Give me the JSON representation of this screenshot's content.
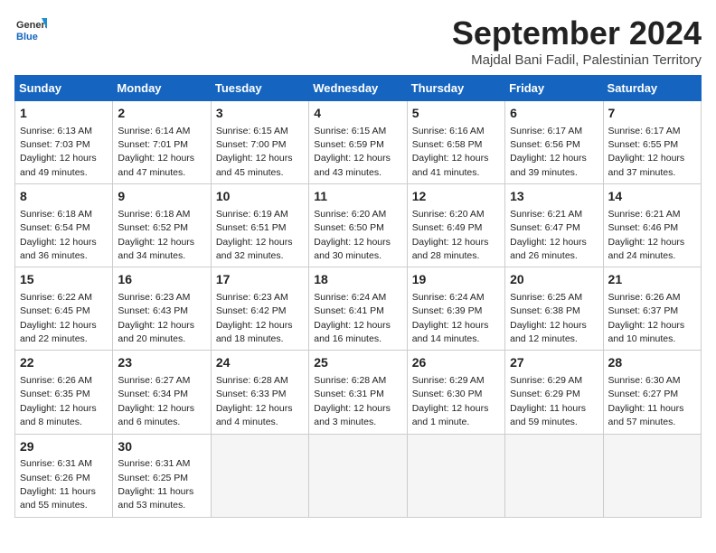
{
  "header": {
    "logo_general": "General",
    "logo_blue": "Blue",
    "title": "September 2024",
    "location": "Majdal Bani Fadil, Palestinian Territory"
  },
  "days_of_week": [
    "Sunday",
    "Monday",
    "Tuesday",
    "Wednesday",
    "Thursday",
    "Friday",
    "Saturday"
  ],
  "weeks": [
    [
      {
        "day": 1,
        "sunrise": "6:13 AM",
        "sunset": "7:03 PM",
        "daylight": "12 hours and 49 minutes."
      },
      {
        "day": 2,
        "sunrise": "6:14 AM",
        "sunset": "7:01 PM",
        "daylight": "12 hours and 47 minutes."
      },
      {
        "day": 3,
        "sunrise": "6:15 AM",
        "sunset": "7:00 PM",
        "daylight": "12 hours and 45 minutes."
      },
      {
        "day": 4,
        "sunrise": "6:15 AM",
        "sunset": "6:59 PM",
        "daylight": "12 hours and 43 minutes."
      },
      {
        "day": 5,
        "sunrise": "6:16 AM",
        "sunset": "6:58 PM",
        "daylight": "12 hours and 41 minutes."
      },
      {
        "day": 6,
        "sunrise": "6:17 AM",
        "sunset": "6:56 PM",
        "daylight": "12 hours and 39 minutes."
      },
      {
        "day": 7,
        "sunrise": "6:17 AM",
        "sunset": "6:55 PM",
        "daylight": "12 hours and 37 minutes."
      }
    ],
    [
      {
        "day": 8,
        "sunrise": "6:18 AM",
        "sunset": "6:54 PM",
        "daylight": "12 hours and 36 minutes."
      },
      {
        "day": 9,
        "sunrise": "6:18 AM",
        "sunset": "6:52 PM",
        "daylight": "12 hours and 34 minutes."
      },
      {
        "day": 10,
        "sunrise": "6:19 AM",
        "sunset": "6:51 PM",
        "daylight": "12 hours and 32 minutes."
      },
      {
        "day": 11,
        "sunrise": "6:20 AM",
        "sunset": "6:50 PM",
        "daylight": "12 hours and 30 minutes."
      },
      {
        "day": 12,
        "sunrise": "6:20 AM",
        "sunset": "6:49 PM",
        "daylight": "12 hours and 28 minutes."
      },
      {
        "day": 13,
        "sunrise": "6:21 AM",
        "sunset": "6:47 PM",
        "daylight": "12 hours and 26 minutes."
      },
      {
        "day": 14,
        "sunrise": "6:21 AM",
        "sunset": "6:46 PM",
        "daylight": "12 hours and 24 minutes."
      }
    ],
    [
      {
        "day": 15,
        "sunrise": "6:22 AM",
        "sunset": "6:45 PM",
        "daylight": "12 hours and 22 minutes."
      },
      {
        "day": 16,
        "sunrise": "6:23 AM",
        "sunset": "6:43 PM",
        "daylight": "12 hours and 20 minutes."
      },
      {
        "day": 17,
        "sunrise": "6:23 AM",
        "sunset": "6:42 PM",
        "daylight": "12 hours and 18 minutes."
      },
      {
        "day": 18,
        "sunrise": "6:24 AM",
        "sunset": "6:41 PM",
        "daylight": "12 hours and 16 minutes."
      },
      {
        "day": 19,
        "sunrise": "6:24 AM",
        "sunset": "6:39 PM",
        "daylight": "12 hours and 14 minutes."
      },
      {
        "day": 20,
        "sunrise": "6:25 AM",
        "sunset": "6:38 PM",
        "daylight": "12 hours and 12 minutes."
      },
      {
        "day": 21,
        "sunrise": "6:26 AM",
        "sunset": "6:37 PM",
        "daylight": "12 hours and 10 minutes."
      }
    ],
    [
      {
        "day": 22,
        "sunrise": "6:26 AM",
        "sunset": "6:35 PM",
        "daylight": "12 hours and 8 minutes."
      },
      {
        "day": 23,
        "sunrise": "6:27 AM",
        "sunset": "6:34 PM",
        "daylight": "12 hours and 6 minutes."
      },
      {
        "day": 24,
        "sunrise": "6:28 AM",
        "sunset": "6:33 PM",
        "daylight": "12 hours and 4 minutes."
      },
      {
        "day": 25,
        "sunrise": "6:28 AM",
        "sunset": "6:31 PM",
        "daylight": "12 hours and 3 minutes."
      },
      {
        "day": 26,
        "sunrise": "6:29 AM",
        "sunset": "6:30 PM",
        "daylight": "12 hours and 1 minute."
      },
      {
        "day": 27,
        "sunrise": "6:29 AM",
        "sunset": "6:29 PM",
        "daylight": "11 hours and 59 minutes."
      },
      {
        "day": 28,
        "sunrise": "6:30 AM",
        "sunset": "6:27 PM",
        "daylight": "11 hours and 57 minutes."
      }
    ],
    [
      {
        "day": 29,
        "sunrise": "6:31 AM",
        "sunset": "6:26 PM",
        "daylight": "11 hours and 55 minutes."
      },
      {
        "day": 30,
        "sunrise": "6:31 AM",
        "sunset": "6:25 PM",
        "daylight": "11 hours and 53 minutes."
      },
      null,
      null,
      null,
      null,
      null
    ]
  ]
}
